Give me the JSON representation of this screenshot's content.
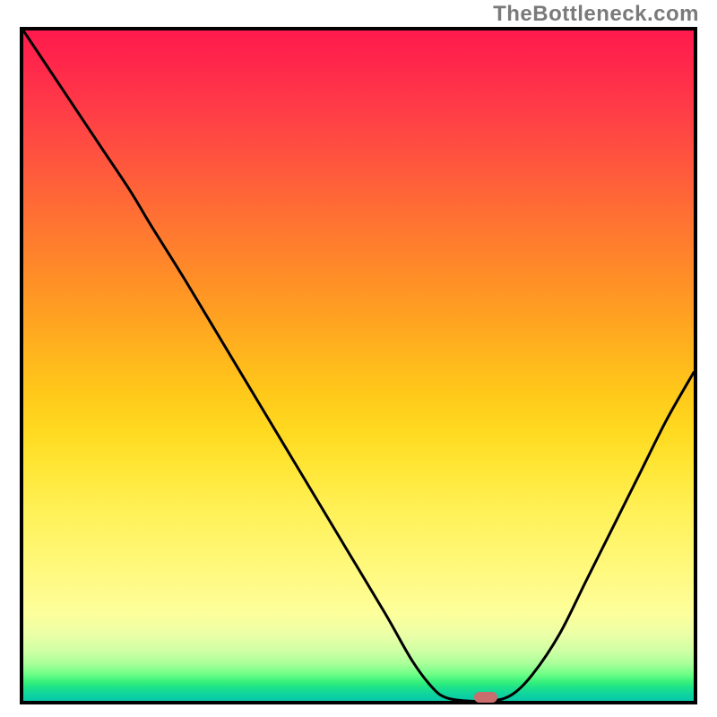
{
  "watermark": "TheBottleneck.com",
  "colors": {
    "frame_border": "#000000",
    "curve_stroke": "#000000",
    "marker_fill": "#c96d6d",
    "gradient_top": "#ff1a4d",
    "gradient_bottom": "#08c8a8"
  },
  "chart_data": {
    "type": "line",
    "title": "",
    "xlabel": "",
    "ylabel": "",
    "xlim": [
      0,
      100
    ],
    "ylim": [
      0,
      100
    ],
    "grid": false,
    "gradient_background": true,
    "points": [
      {
        "x": 0,
        "y": 100
      },
      {
        "x": 4,
        "y": 94
      },
      {
        "x": 8,
        "y": 88
      },
      {
        "x": 12,
        "y": 82
      },
      {
        "x": 16,
        "y": 76
      },
      {
        "x": 19,
        "y": 71
      },
      {
        "x": 24,
        "y": 63
      },
      {
        "x": 30,
        "y": 53
      },
      {
        "x": 36,
        "y": 43
      },
      {
        "x": 42,
        "y": 33
      },
      {
        "x": 48,
        "y": 23
      },
      {
        "x": 54,
        "y": 13
      },
      {
        "x": 58,
        "y": 6
      },
      {
        "x": 61,
        "y": 2
      },
      {
        "x": 63,
        "y": 0.5
      },
      {
        "x": 66,
        "y": 0
      },
      {
        "x": 70,
        "y": 0
      },
      {
        "x": 73,
        "y": 1
      },
      {
        "x": 76,
        "y": 4
      },
      {
        "x": 80,
        "y": 10
      },
      {
        "x": 84,
        "y": 18
      },
      {
        "x": 88,
        "y": 26
      },
      {
        "x": 92,
        "y": 34
      },
      {
        "x": 96,
        "y": 42
      },
      {
        "x": 100,
        "y": 49
      }
    ],
    "marker": {
      "x": 69,
      "y": 0.5,
      "shape": "rounded-rect",
      "color": "#c96d6d"
    }
  }
}
